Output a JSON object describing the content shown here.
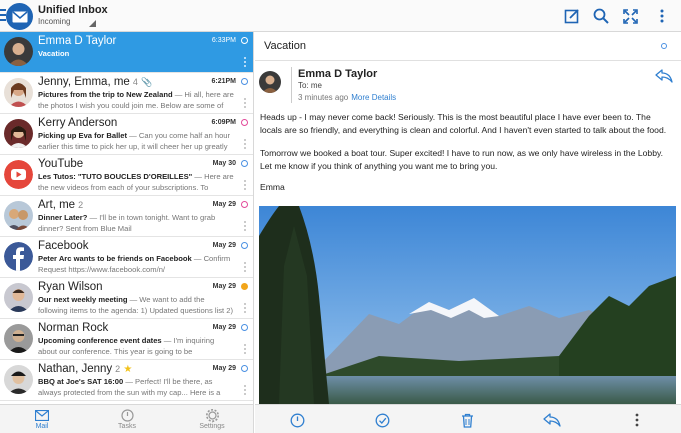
{
  "header": {
    "title": "Unified Inbox",
    "subtitle": "Incoming",
    "icons": [
      "compose-icon",
      "search-icon",
      "expand-icon",
      "overflow-menu-icon"
    ]
  },
  "messages": [
    {
      "sender": "Emma D Taylor",
      "count": "",
      "date": "6:33PM",
      "subject": "Vacation",
      "snippet": "",
      "dot": "blue",
      "selected": true,
      "avatar_color": "#3a3a3a"
    },
    {
      "sender": "Jenny, Emma, me",
      "count": "4",
      "date": "6:21PM",
      "subject": "Pictures from the trip to New Zealand",
      "snippet": " — Hi all, here are the photos I wish you could join me. Below are some of the pictures I",
      "dot": "blue",
      "attachment": true,
      "avatar_color": "#b07050"
    },
    {
      "sender": "Kerry Anderson",
      "count": "",
      "date": "6:09PM",
      "subject": "Picking up Eva for Ballet",
      "snippet": " — Can you come half an hour earlier this time to pick her up, it will cheer her up greatly",
      "dot": "pink",
      "avatar_color": "#6a2a2a"
    },
    {
      "sender": "YouTube",
      "count": "",
      "date": "May 30",
      "subject": "Les Tutos: \"TUTO BOUCLES D'OREILLES\"",
      "snippet": " — Here are the new videos from each of your subscriptions. To",
      "dot": "blue",
      "avatar_color": "#e5463b"
    },
    {
      "sender": "Art, me",
      "count": "2",
      "date": "May 29",
      "subject": "Dinner Later?",
      "snippet": " — I'll be in town tonight. Want to grab dinner? Sent from Blue Mail",
      "dot": "pink",
      "avatar_color": "#8a6a4a"
    },
    {
      "sender": "Facebook",
      "count": "",
      "date": "May 29",
      "subject": "Peter Arc wants to be friends on Facebook",
      "snippet": " — Confirm Request https://www.facebook.com/n/",
      "dot": "blue",
      "avatar_color": "#3b5998"
    },
    {
      "sender": "Ryan Wilson",
      "count": "",
      "date": "May 29",
      "subject": "Our next weekly meeting",
      "snippet": " — We want to add the following items to the agenda: 1) Updated questions list 2)",
      "dot": "orange",
      "avatar_color": "#4a4a5a"
    },
    {
      "sender": "Norman Rock",
      "count": "",
      "date": "May 29",
      "subject": "Upcoming conference event dates",
      "snippet": " — I'm inquiring about our conference. This year is going to be",
      "dot": "blue",
      "avatar_color": "#5a5a5a"
    },
    {
      "sender": "Nathan, Jenny",
      "count": "2",
      "date": "May 29",
      "subject": "BBQ at Joe's SAT 16:00",
      "snippet": " — Perfect! I'll be there, as always protected from the sun with my cap... Here is a picture",
      "dot": "blue",
      "star": true,
      "avatar_color": "#2a2a2a"
    }
  ],
  "nav": [
    {
      "label": "Mail",
      "icon": "mail-icon",
      "active": true
    },
    {
      "label": "Tasks",
      "icon": "clock-icon",
      "active": false
    },
    {
      "label": "Settings",
      "icon": "settings-gear-icon",
      "active": false
    }
  ],
  "email": {
    "subject": "Vacation",
    "from": "Emma D Taylor",
    "to": "To: me",
    "time": "3 minutes ago",
    "more_details": "More Details",
    "paragraph1": "Heads up - I may never come back! Seriously. This is the most beautiful place I have ever been to. The locals are so friendly, and everything is clean and colorful. And I haven't even started to talk about the food.",
    "paragraph2": "Tomorrow we booked a boat tour. Super excited! I have to run now, as we only have wireless in the Lobby. Let me know if you think of anything you want me to bring you.",
    "signature": "Emma"
  },
  "actions": [
    "snooze-clock-icon",
    "mark-done-icon",
    "delete-trash-icon",
    "reply-icon",
    "more-icon"
  ],
  "colors": {
    "accent": "#2f9ae3",
    "brand": "#1e64b4",
    "link": "#2f7fd0"
  }
}
